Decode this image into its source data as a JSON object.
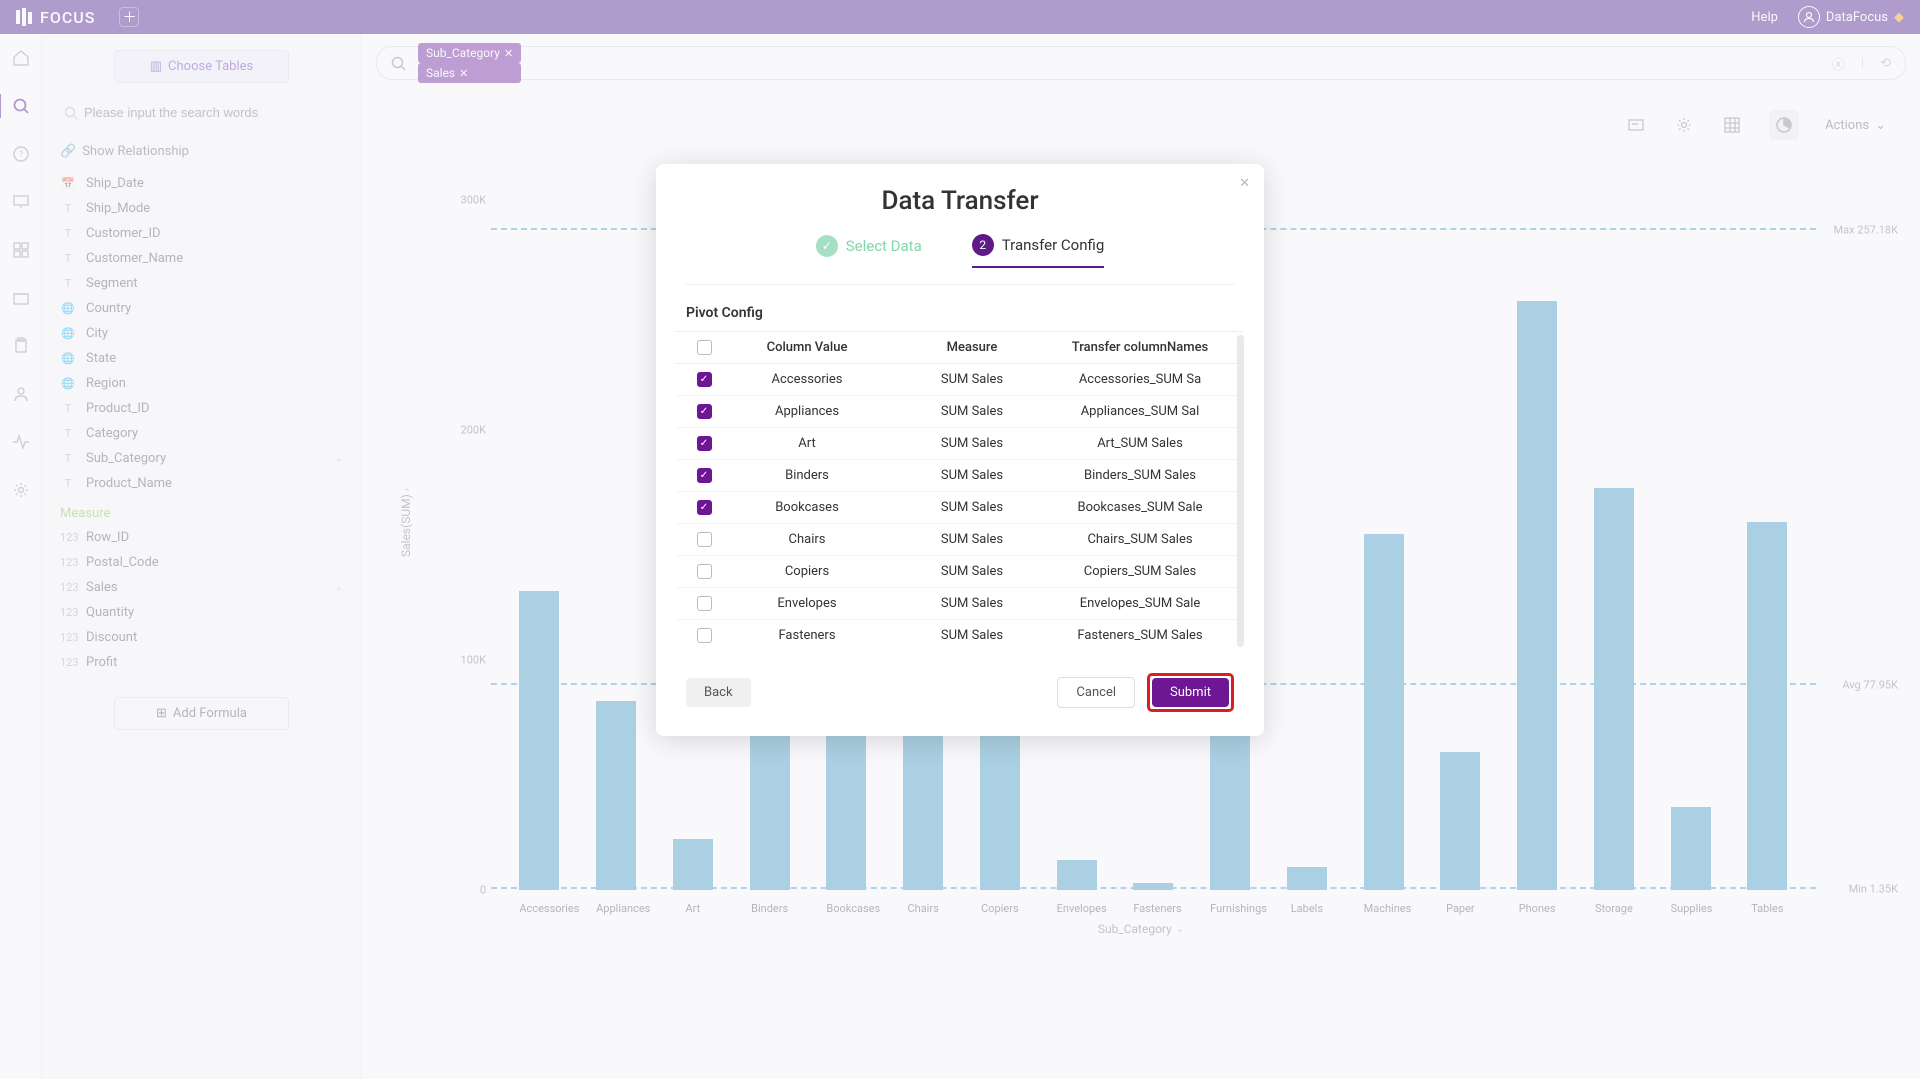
{
  "brand": "FOCUS",
  "topbar": {
    "help": "Help",
    "user": "DataFocus"
  },
  "sidebar": {
    "choose_tables": "Choose Tables",
    "search_placeholder": "Please input the search words",
    "show_relationship": "Show Relationship",
    "fields": [
      {
        "icon": "cal",
        "label": "Ship_Date"
      },
      {
        "icon": "T",
        "label": "Ship_Mode"
      },
      {
        "icon": "T",
        "label": "Customer_ID"
      },
      {
        "icon": "T",
        "label": "Customer_Name"
      },
      {
        "icon": "T",
        "label": "Segment"
      },
      {
        "icon": "globe",
        "label": "Country"
      },
      {
        "icon": "globe",
        "label": "City"
      },
      {
        "icon": "globe",
        "label": "State"
      },
      {
        "icon": "globe",
        "label": "Region"
      },
      {
        "icon": "T",
        "label": "Product_ID"
      },
      {
        "icon": "T",
        "label": "Category"
      },
      {
        "icon": "T",
        "label": "Sub_Category",
        "expand": true
      },
      {
        "icon": "T",
        "label": "Product_Name"
      }
    ],
    "measure_title": "Measure",
    "measures": [
      {
        "label": "Row_ID"
      },
      {
        "label": "Postal_Code"
      },
      {
        "label": "Sales",
        "expand": true
      },
      {
        "label": "Quantity"
      },
      {
        "label": "Discount"
      },
      {
        "label": "Profit"
      }
    ],
    "add_formula": "Add Formula"
  },
  "query": {
    "chips": [
      "Sub_Category",
      "Sales"
    ]
  },
  "chart_toolbar": {
    "actions": "Actions"
  },
  "chart_data": {
    "type": "bar",
    "title": "",
    "xlabel": "Sub_Category",
    "ylabel": "Sales(SUM)",
    "ylim": [
      0,
      300000
    ],
    "yticks": [
      "300K",
      "200K",
      "100K",
      "0"
    ],
    "categories": [
      "Accessories",
      "Appliances",
      "Art",
      "Binders",
      "Bookcases",
      "Chairs",
      "Copiers",
      "Envelopes",
      "Fasteners",
      "Furnishings",
      "Labels",
      "Machines",
      "Paper",
      "Phones",
      "Storage",
      "Supplies",
      "Tables"
    ],
    "values": [
      130000,
      82000,
      22000,
      148000,
      83000,
      257180,
      117000,
      13000,
      3000,
      72000,
      10000,
      155000,
      60000,
      256000,
      175000,
      36000,
      160000
    ],
    "reference_lines": {
      "max": {
        "label": "Max 257.18K",
        "value": 257180
      },
      "avg": {
        "label": "Avg 77.95K",
        "value": 77950
      },
      "min": {
        "label": "Min 1.35K",
        "value": 1350
      }
    }
  },
  "modal": {
    "title": "Data Transfer",
    "step1": "Select Data",
    "step2": "Transfer Config",
    "pivot_config": "Pivot Config",
    "columns": {
      "cv": "Column Value",
      "me": "Measure",
      "tn": "Transfer columnNames"
    },
    "rows": [
      {
        "checked": true,
        "cv": "Accessories",
        "me": "SUM Sales",
        "tn": "Accessories_SUM Sa"
      },
      {
        "checked": true,
        "cv": "Appliances",
        "me": "SUM Sales",
        "tn": "Appliances_SUM Sal"
      },
      {
        "checked": true,
        "cv": "Art",
        "me": "SUM Sales",
        "tn": "Art_SUM Sales"
      },
      {
        "checked": true,
        "cv": "Binders",
        "me": "SUM Sales",
        "tn": "Binders_SUM Sales"
      },
      {
        "checked": true,
        "cv": "Bookcases",
        "me": "SUM Sales",
        "tn": "Bookcases_SUM Sale"
      },
      {
        "checked": false,
        "cv": "Chairs",
        "me": "SUM Sales",
        "tn": "Chairs_SUM Sales"
      },
      {
        "checked": false,
        "cv": "Copiers",
        "me": "SUM Sales",
        "tn": "Copiers_SUM Sales"
      },
      {
        "checked": false,
        "cv": "Envelopes",
        "me": "SUM Sales",
        "tn": "Envelopes_SUM Sale"
      },
      {
        "checked": false,
        "cv": "Fasteners",
        "me": "SUM Sales",
        "tn": "Fasteners_SUM Sales"
      }
    ],
    "back": "Back",
    "cancel": "Cancel",
    "submit": "Submit"
  }
}
